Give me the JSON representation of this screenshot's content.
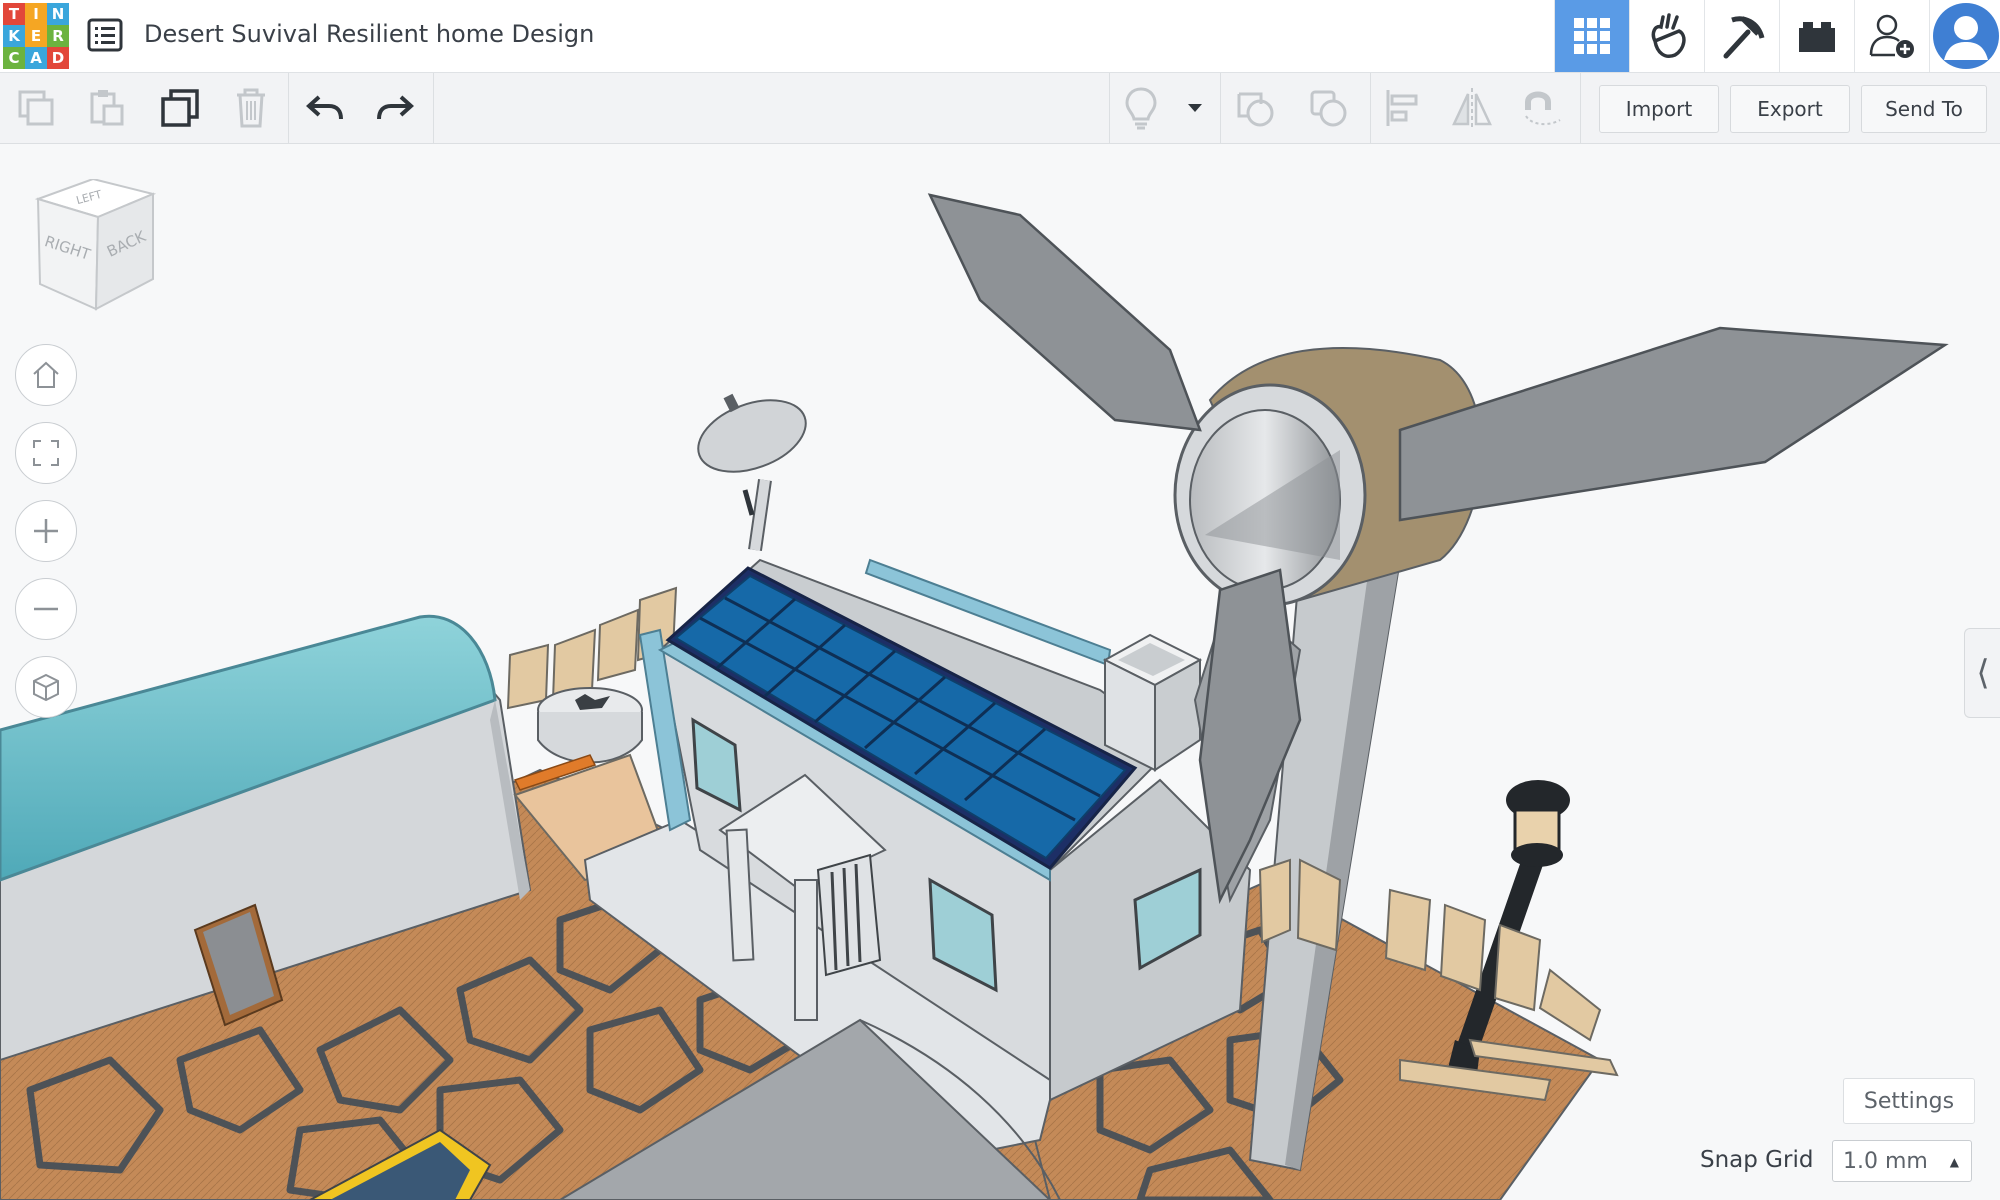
{
  "app": {
    "logo_letters": [
      "T",
      "I",
      "N",
      "K",
      "E",
      "R",
      "C",
      "A",
      "D"
    ],
    "logo_colors": [
      "#e2473a",
      "#f5a623",
      "#3aa6dc",
      "#3aa6dc",
      "#f5a623",
      "#6cb33f",
      "#6cb33f",
      "#3aa6dc",
      "#e2473a"
    ],
    "title": "Desert Suvival Resilient home Design"
  },
  "modes": [
    {
      "name": "3d-design",
      "icon": "grid-icon",
      "active": true
    },
    {
      "name": "circuits",
      "icon": "hand-icon",
      "active": false
    },
    {
      "name": "codeblocks",
      "icon": "pickaxe-icon",
      "active": false
    },
    {
      "name": "bricks",
      "icon": "brick-icon",
      "active": false
    },
    {
      "name": "invite",
      "icon": "add-user-icon",
      "active": false
    },
    {
      "name": "profile",
      "icon": "avatar-icon",
      "active": false
    }
  ],
  "toolbar": {
    "import_label": "Import",
    "export_label": "Export",
    "send_to_label": "Send To"
  },
  "view_cube": {
    "top_label": "LEFT",
    "right_label": "RIGHT",
    "back_label": "BACK"
  },
  "footer": {
    "settings_label": "Settings",
    "snap_grid_label": "Snap Grid",
    "snap_grid_value": "1.0 mm"
  },
  "colors": {
    "accent": "#5a9be6",
    "solar": "#1669a8",
    "greenhouse_roof": "#7cc7d0",
    "ground": "#c28a57",
    "walls": "#d6d9dc"
  }
}
